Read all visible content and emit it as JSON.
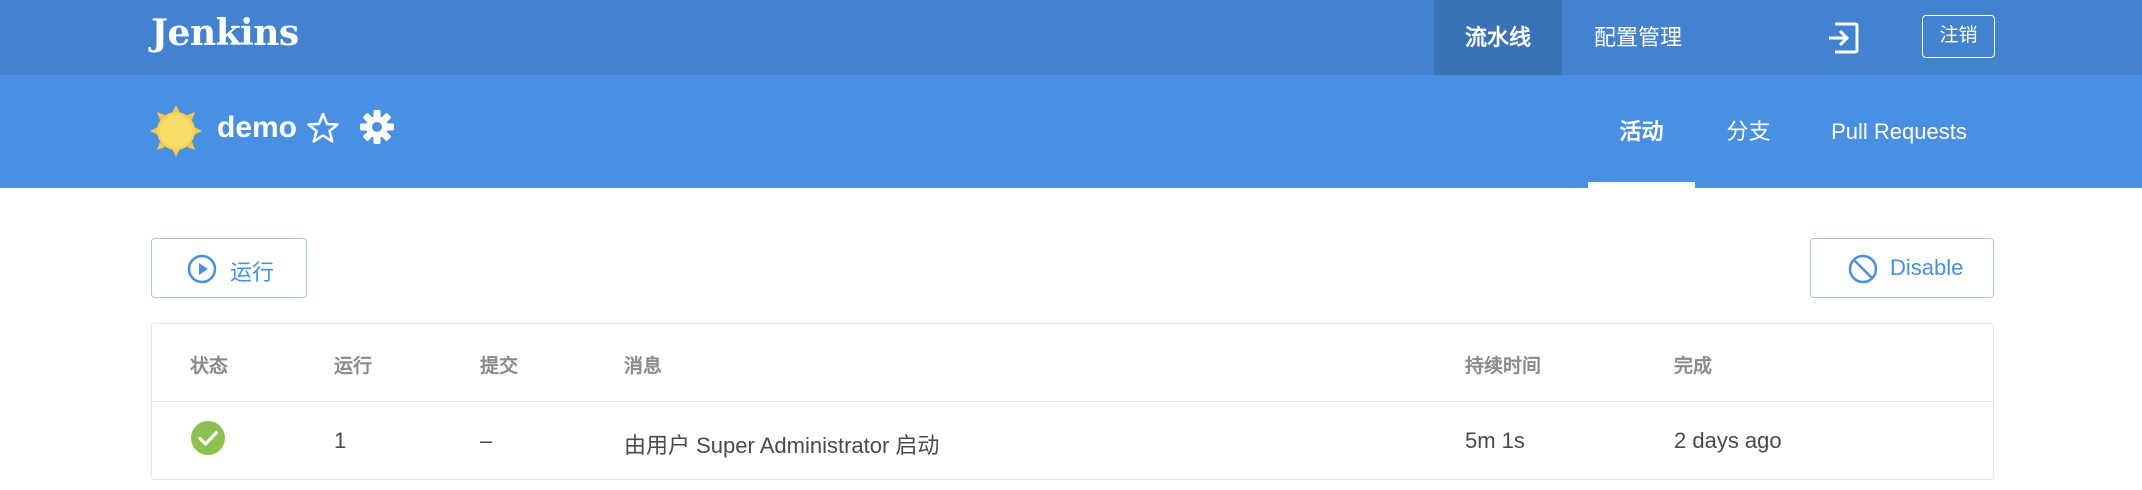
{
  "topbar": {
    "brand": "Jenkins",
    "nav": [
      {
        "label": "流水线",
        "active": true
      },
      {
        "label": "配置管理",
        "active": false
      }
    ],
    "logout_icon": "logout-icon",
    "signout_label": "注销",
    "bg_color": "#4282cf"
  },
  "header": {
    "job_name": "demo",
    "weather_icon": "sunny-weather-icon",
    "favorite_icon": "star-icon",
    "settings_icon": "gear-icon",
    "tabs": [
      {
        "label": "活动",
        "active": true
      },
      {
        "label": "分支",
        "active": false
      },
      {
        "label": "Pull Requests",
        "active": false
      }
    ],
    "bg_color": "#4a90e2"
  },
  "actions": {
    "run_label": "运行",
    "run_icon": "play-circle-icon",
    "disable_label": "Disable",
    "disable_icon": "disabled-circle-icon"
  },
  "table": {
    "headers": {
      "status": "状态",
      "run": "运行",
      "commit": "提交",
      "message": "消息",
      "duration": "持续时间",
      "completed": "完成"
    },
    "rows": [
      {
        "status": "success",
        "status_color": "#8cc04f",
        "run": "1",
        "commit": "–",
        "message": "由用户 Super Administrator 启动",
        "duration": "5m 1s",
        "completed": "2 days ago"
      }
    ]
  }
}
